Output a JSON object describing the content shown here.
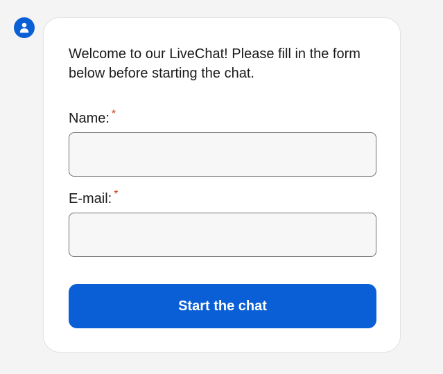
{
  "avatar": {
    "icon": "user-icon",
    "color": "#0a5fd7"
  },
  "form": {
    "intro_text": "Welcome to our LiveChat! Please fill in the form below before starting the chat.",
    "name_label": "Name:",
    "name_required_mark": "*",
    "name_value": "",
    "email_label": "E-mail:",
    "email_required_mark": "*",
    "email_value": "",
    "submit_label": "Start the chat",
    "accent_color": "#0a5fd7",
    "required_color": "#c8401a"
  }
}
